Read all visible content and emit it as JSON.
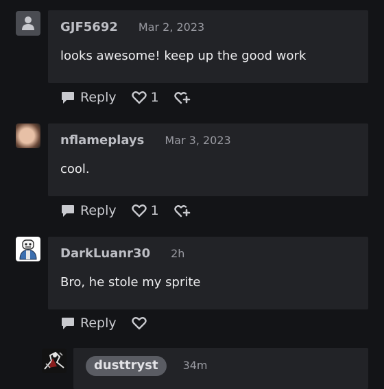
{
  "comments": [
    {
      "author": "GJF5692",
      "date": "Mar 2, 2023",
      "text": "looks awesome! keep up the good work",
      "reply_label": "Reply",
      "likes": "1"
    },
    {
      "author": "nflameplays",
      "date": "Mar 3, 2023",
      "text": "cool.",
      "reply_label": "Reply",
      "likes": "1"
    },
    {
      "author": "DarkLuanr30",
      "date": "2h",
      "text": "Bro, he stole my sprite",
      "reply_label": "Reply"
    }
  ],
  "reply": {
    "author": "dusttryst",
    "date": "34m"
  },
  "icons": {
    "avatar_default": "user-silhouette-icon",
    "reply": "speech-bubble-icon",
    "like": "heart-outline-icon",
    "add_reaction": "heart-plus-icon"
  },
  "colors": {
    "background": "#131417",
    "bubble": "#222327",
    "author_text": "#bdbec4",
    "meta_text": "#9a9ba2",
    "chip": "#5a5c63"
  }
}
